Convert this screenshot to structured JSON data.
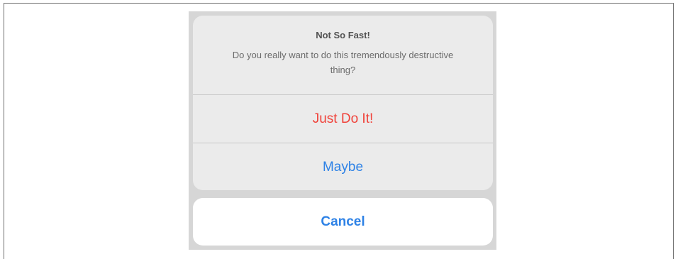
{
  "alert": {
    "title": "Not So Fast!",
    "message": "Do you really want to do this tremendously destructive thing?",
    "actions": [
      {
        "label": "Just Do It!",
        "style": "destructive",
        "color": "#f0423a"
      },
      {
        "label": "Maybe",
        "style": "default",
        "color": "#2e82e6"
      }
    ],
    "cancel_label": "Cancel"
  },
  "colors": {
    "accent": "#2e82e6",
    "destructive": "#f0423a",
    "sheet_background": "#ebebeb",
    "backdrop": "#d6d6d6"
  }
}
